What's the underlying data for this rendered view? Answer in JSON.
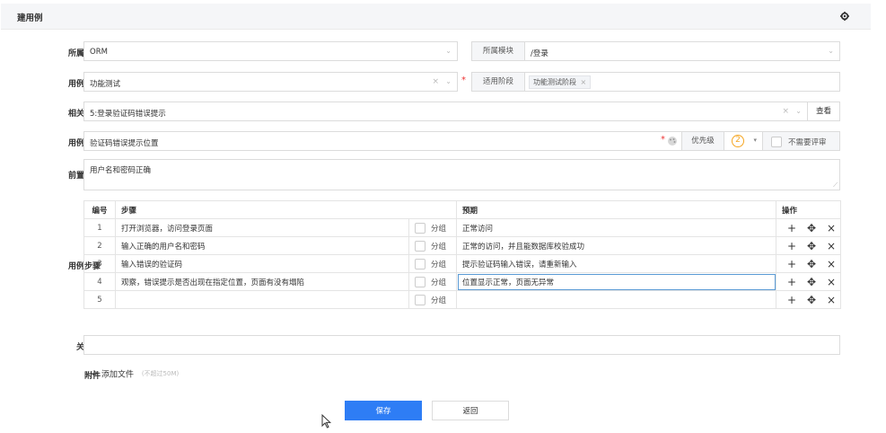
{
  "header": {
    "title": "建用例",
    "settings_icon": "gear-icon"
  },
  "form": {
    "product": {
      "label": "所属产品",
      "value": "ORM"
    },
    "module": {
      "label": "所属模块",
      "value": "/登录"
    },
    "case_type": {
      "label": "用例类型",
      "value": "功能测试"
    },
    "stage": {
      "label": "适用阶段",
      "tag": "功能测试阶段"
    },
    "requirement": {
      "label": "相关需求",
      "value": "5:登录验证码错误提示",
      "view_button": "查看"
    },
    "case_title": {
      "label": "用例标题",
      "value": "验证码错误提示位置",
      "priority_label": "优先级",
      "priority_value": "2",
      "no_review_label": "不需要评审"
    },
    "precondition": {
      "label": "前置条件",
      "value": "用户名和密码正确"
    },
    "steps_label": "用例步骤",
    "steps_table": {
      "headers": {
        "num": "编号",
        "step": "步骤",
        "expect": "预期",
        "ops": "操作"
      },
      "group_label": "分组",
      "rows": [
        {
          "num": "1",
          "step": "打开浏览器，访问登录页面",
          "expect": "正常访问"
        },
        {
          "num": "2",
          "step": "输入正确的用户名和密码",
          "expect": "正常的访问，并且能数据库校验成功"
        },
        {
          "num": "3",
          "step": "输入错误的验证码",
          "expect": "提示验证码输入错误，请重新输入"
        },
        {
          "num": "4",
          "step": "观察，错误提示是否出现在指定位置，页面有没有塌陷",
          "expect": "位置显示正常，页面无异常"
        },
        {
          "num": "5",
          "step": "",
          "expect": ""
        }
      ]
    },
    "keywords": {
      "label": "关键词",
      "value": ""
    },
    "attachment": {
      "label": "附件",
      "add_label": "添加文件",
      "hint": "(不超过50M)"
    }
  },
  "actions": {
    "save": "保存",
    "back": "返回"
  },
  "colors": {
    "primary": "#2e7df5",
    "required": "#ee3333",
    "priority": "#f5a623"
  }
}
